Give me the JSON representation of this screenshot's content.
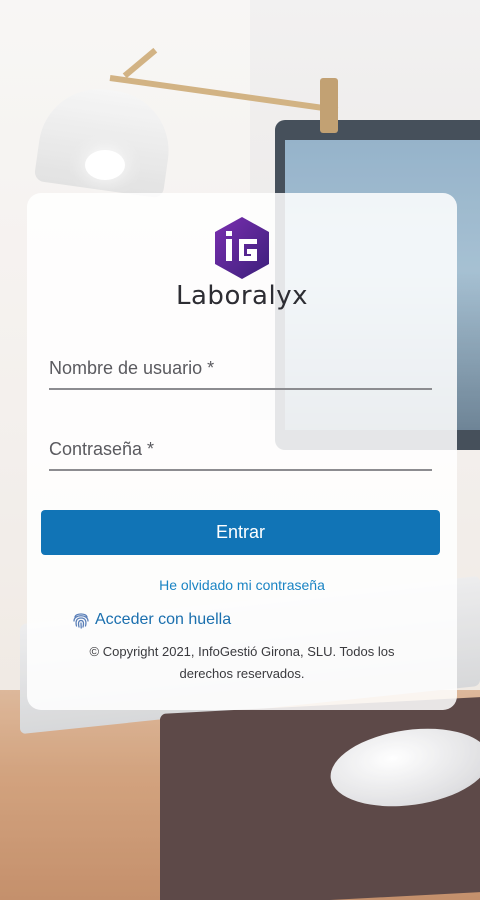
{
  "app": {
    "brand_name": "Laboralyx",
    "logo_letters": "iG"
  },
  "login": {
    "username_label": "Nombre de usuario *",
    "password_label": "Contraseña *",
    "submit_label": "Entrar",
    "forgot_password_label": "He olvidado mi contraseña",
    "fingerprint_label": "Acceder con huella",
    "copyright_text": "© Copyright 2021, InfoGestió Girona, SLU. Todos los derechos reservados."
  },
  "icons": {
    "logo": "hexagon-logo-icon",
    "fingerprint": "fingerprint-icon"
  },
  "colors": {
    "accent": "#1174b6",
    "link": "#1a84c4",
    "logo_purple": "#5b2a8c"
  }
}
